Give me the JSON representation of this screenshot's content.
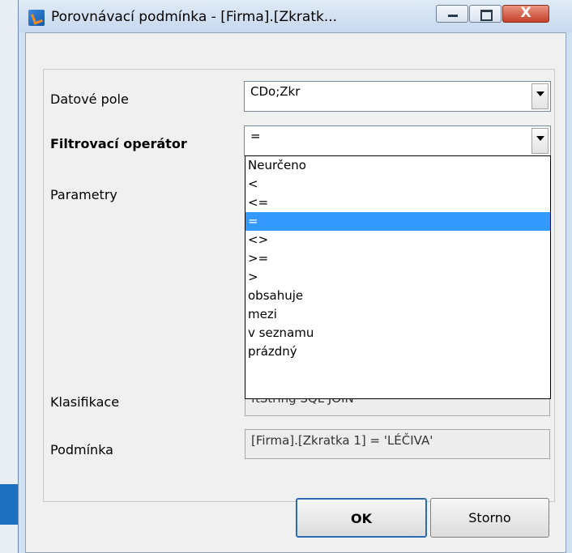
{
  "window": {
    "title": "Porovnávací podmínka - [Firma].[Zkratk...",
    "close_glyph": "X"
  },
  "form": {
    "data_field_label": "Datové pole",
    "data_field_value": "CDo;Zkr",
    "operator_label": "Filtrovací operátor",
    "operator_value": "=",
    "parameters_label": "Parametry",
    "classification_label": "Klasifikace",
    "classification_value": "ftString SQL JOIN",
    "condition_label": "Podmínka",
    "condition_value": "[Firma].[Zkratka 1] = 'LÉČIVA'"
  },
  "dropdown": {
    "selected_index": 3,
    "items": [
      "Neurčeno",
      "<",
      "<=",
      "=",
      "<>",
      ">=",
      ">",
      "obsahuje",
      "mezi",
      "v seznamu",
      "prázdný"
    ]
  },
  "buttons": {
    "ok": "OK",
    "cancel": "Storno"
  },
  "colors": {
    "selection": "#3399ff",
    "ok_border": "#2b6cb3"
  },
  "icons": {
    "app": "app-logo-icon",
    "minimize": "minimize-icon",
    "maximize": "maximize-icon",
    "close": "close-icon",
    "dropdown": "chevron-down-icon"
  }
}
